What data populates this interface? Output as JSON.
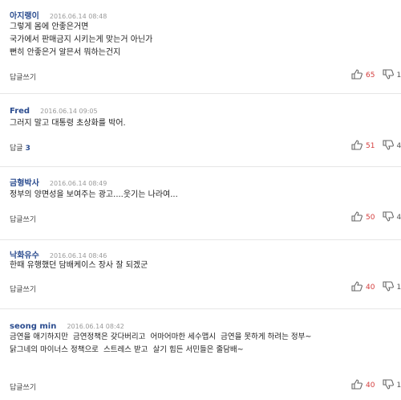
{
  "comments": [
    {
      "author": "아지랭이",
      "date": "2016.06.14 08:48",
      "lines": [
        "그렇게 몸에 안좋은거면",
        "국가에서 판매금지 시키는게 맞는거 아닌가",
        "뻔히 안좋은거 알믄서 뭐하는건지"
      ],
      "reply": "답글쓰기",
      "reply_count": "",
      "likes": "65",
      "dislikes": "1"
    },
    {
      "author": "Fred",
      "date": "2016.06.14 09:05",
      "lines": [
        "그러지 말고 대통령 초상화를 박어."
      ],
      "reply": "답글",
      "reply_count": "3",
      "likes": "51",
      "dislikes": "4"
    },
    {
      "author": "금형박사",
      "date": "2016.06.14 08:49",
      "lines": [
        "정부의 양면성을 보여주는 광고....웃기는 나라여..."
      ],
      "reply": "답글쓰기",
      "reply_count": "",
      "likes": "50",
      "dislikes": "4"
    },
    {
      "author": "낙화유수",
      "date": "2016.06.14 08:46",
      "lines": [
        "한때 유행했던 담배케이스 장사 잘 되겠군"
      ],
      "reply": "답글쓰기",
      "reply_count": "",
      "likes": "40",
      "dislikes": "1"
    },
    {
      "author": "seong min",
      "date": "2016.06.14 08:42",
      "lines": [
        "금연을 애기하지만  금연정책은 갖다버리고  어마어마한 세수맵시  금연을 못하게 하려는 정부~",
        "",
        "닭그네의 마이너스 정책으로  스트레스 받고  살기 힘든 서민들은 줄담배~"
      ],
      "reply": "답글쓰기",
      "reply_count": "",
      "likes": "40",
      "dislikes": "1"
    }
  ]
}
